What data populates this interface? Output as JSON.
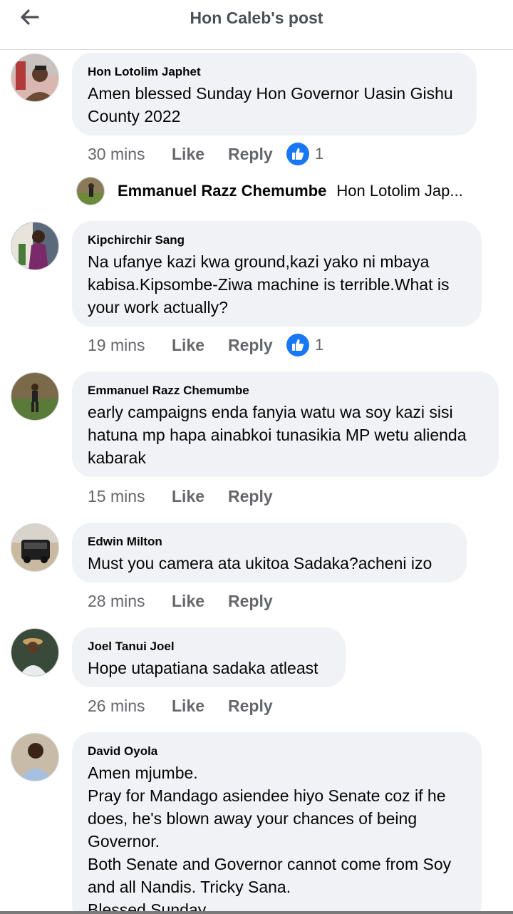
{
  "header": {
    "title": "Hon Caleb's post"
  },
  "comments": [
    {
      "author": "Hon Lotolim Japhet",
      "text": "Amen blessed Sunday Hon Governor Uasin Gishu\nCounty 2022",
      "time": "30 mins",
      "like": "Like",
      "reply": "Reply",
      "reactions": "1"
    },
    {
      "author": "Kipchirchir Sang",
      "text": "Na ufanye kazi kwa ground,kazi yako ni mbaya\nkabisa.Kipsombe-Ziwa machine is terrible.What is\nyour work actually?",
      "time": "19 mins",
      "like": "Like",
      "reply": "Reply",
      "reactions": "1"
    },
    {
      "author": "Emmanuel Razz Chemumbe",
      "text": "early campaigns enda fanyia watu wa soy kazi sisi\nhatuna mp hapa ainabkoi tunasikia MP wetu aliend​a\nkabarak",
      "time": "15 mins",
      "like": "Like",
      "reply": "Reply"
    },
    {
      "author": "Edwin Milton",
      "text": "Must you camera ata ukitoa Sadaka?acheni izo",
      "time": "28 mins",
      "like": "Like",
      "reply": "Reply"
    },
    {
      "author": "Joel Tanui Joel",
      "text": "Hope utapatiana sadaka atleast",
      "time": "26 mins",
      "like": "Like",
      "reply": "Reply"
    },
    {
      "author": "David Oyola",
      "text": "Amen mjumbe.\nPray for Mandago asiendee hiyo Senate coz if he\ndoes, he's blown away your chances of being\nGovernor.\nBoth Senate and Governor cannot come from Soy\nand all Nandis. Tricky Sana.\nBlessed Sunday"
    }
  ],
  "reply_preview": {
    "author": "Emmanuel Razz Chemumbe",
    "snippet": "Hon Lotolim Jap..."
  },
  "colors": {
    "accent": "#1877f2",
    "bubble": "#f0f2f5",
    "muted": "#65676b"
  }
}
